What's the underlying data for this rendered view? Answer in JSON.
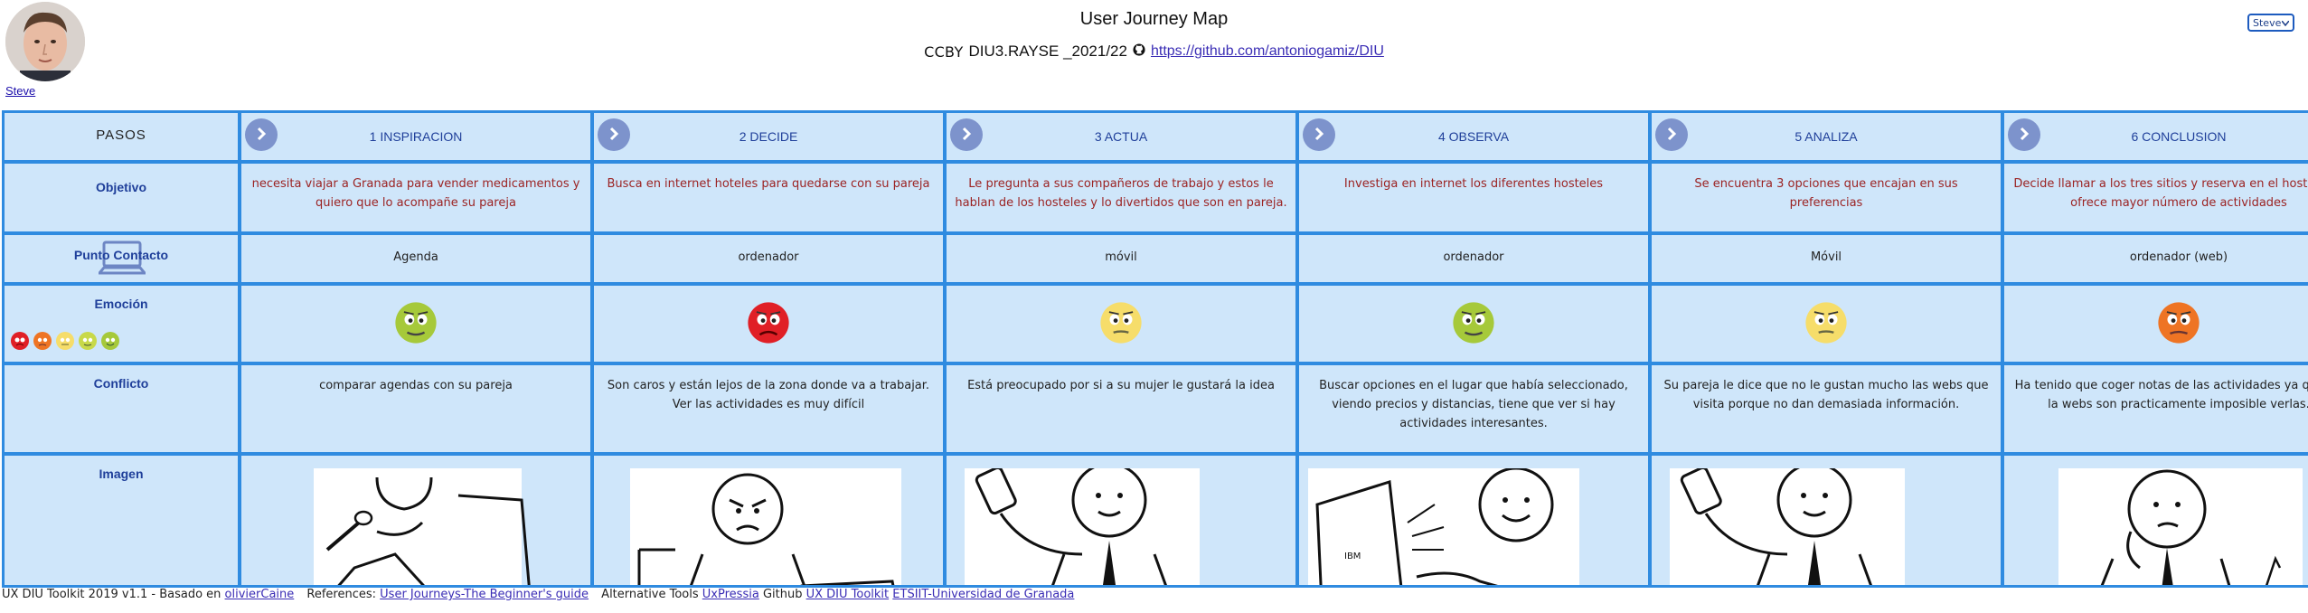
{
  "header": {
    "title": "User Journey Map",
    "license_label": "CCBY",
    "course": "DIU3.RAYSE _2021/22",
    "repo_link": "https://github.com/antoniogamiz/DIU"
  },
  "user": {
    "name": "Steve",
    "select_value": "Steve"
  },
  "rows": {
    "pasos": "PASOS",
    "objetivo": "Objetivo",
    "punto_contacto": "Punto Contacto",
    "emocion": "Emoción",
    "conflicto": "Conflicto",
    "imagen": "Imagen"
  },
  "steps": [
    {
      "title": "1 INSPIRACION",
      "objetivo": "necesita viajar a Granada para vender medicamentos y quiero que lo acompañe su pareja",
      "contacto": "Agenda",
      "emotion": "green",
      "conflicto": "comparar agendas con su pareja",
      "illustration": "person-writing"
    },
    {
      "title": "2 DECIDE",
      "objetivo": "Busca en internet hoteles para quedarse con su pareja",
      "contacto": "ordenador",
      "emotion": "red",
      "conflicto": "Son caros y están lejos de la zona donde va a trabajar. Ver las actividades es muy difícil",
      "illustration": "person-angry-laptop"
    },
    {
      "title": "3 ACTUA",
      "objetivo": "Le pregunta a sus compañeros de trabajo y estos le hablan de los hosteles y lo divertidos que son en pareja.",
      "contacto": "móvil",
      "emotion": "yellow",
      "conflicto": "Está preocupado por si a su mujer le gustará la idea",
      "illustration": "person-phone"
    },
    {
      "title": "4 OBSERVA",
      "objetivo": "Investiga en internet los diferentes hosteles",
      "contacto": "ordenador",
      "emotion": "green",
      "conflicto": "Buscar opciones en el lugar que había seleccionado, viendo precios y distancias, tiene que ver si hay actividades interesantes.",
      "illustration": "person-laptop-happy"
    },
    {
      "title": "5 ANALIZA",
      "objetivo": "Se encuentra 3 opciones que encajan en sus preferencias",
      "contacto": "Móvil",
      "emotion": "yellow",
      "conflicto": "Su pareja le dice que no le gustan mucho las webs que visita porque no dan demasiada información.",
      "illustration": "person-phone"
    },
    {
      "title": "6 CONCLUSION",
      "objetivo": "Decide llamar a los tres sitios y reserva en el hostel que ofrece mayor número de actividades",
      "contacto": "ordenador (web)",
      "emotion": "orange",
      "conflicto": "Ha tenido que coger notas de las actividades ya que en la webs son practicamente imposible verlas.",
      "illustration": "person-thinking"
    }
  ],
  "emotion_colors": {
    "red": "#e01f26",
    "orange": "#ee7424",
    "yellow": "#f6dd6a",
    "lightgreen": "#c8d94a",
    "green": "#a6c93a"
  },
  "footer": {
    "toolkit": "UX DIU Toolkit 2019 v1.1 - Basado en",
    "toolkit_link": "olivierCaine",
    "references_label": "References:",
    "references_link": "User Journeys-The Beginner's guide",
    "alt_tools_label": "Alternative Tools",
    "alt_tools_link": "UxPressia",
    "github_label": "Github",
    "github_link": "UX DIU Toolkit",
    "etsiit_link": "ETSIIT-Universidad de Granada"
  }
}
